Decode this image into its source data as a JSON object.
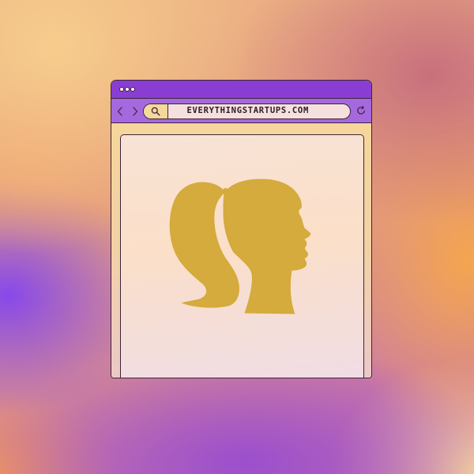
{
  "browser": {
    "titlebar": {
      "control_icon": "window-dot-icon"
    },
    "toolbar": {
      "back_icon": "chevron-left-icon",
      "forward_icon": "chevron-right-icon",
      "search_icon": "search-icon",
      "url": "EVERYTHINGSTARTUPS.COM",
      "reload_icon": "reload-icon"
    },
    "content": {
      "illustration_icon": "woman-ponytail-silhouette-icon"
    }
  },
  "colors": {
    "titlebar": "#8a3dd3",
    "toolbar": "#a568de",
    "outline": "#3a2637",
    "search_segment": "#f5d89c",
    "url_field": "#f6e0de",
    "window_body": "#f5d49a",
    "silhouette": "#d4ab3c"
  }
}
